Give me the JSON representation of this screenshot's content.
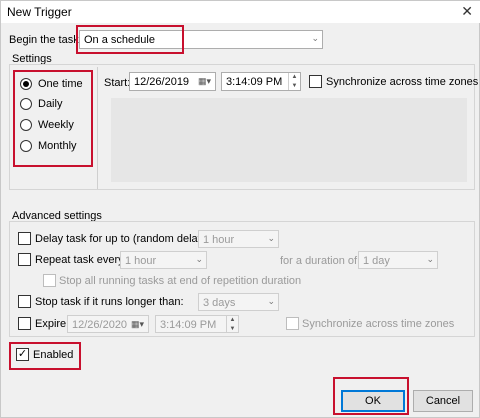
{
  "window": {
    "title": "New Trigger",
    "close_glyph": "✕"
  },
  "begin": {
    "label": "Begin the task:",
    "value": "On a schedule"
  },
  "settings": {
    "label": "Settings",
    "radios": [
      {
        "label": "One time",
        "checked": true
      },
      {
        "label": "Daily",
        "checked": false
      },
      {
        "label": "Weekly",
        "checked": false
      },
      {
        "label": "Monthly",
        "checked": false
      }
    ],
    "start_label": "Start:",
    "start_date": "12/26/2019",
    "start_time": "3:14:09 PM",
    "sync_label": "Synchronize across time zones"
  },
  "advanced": {
    "label": "Advanced settings",
    "delay_label": "Delay task for up to (random delay):",
    "delay_value": "1 hour",
    "repeat_label": "Repeat task every:",
    "repeat_value": "1 hour",
    "duration_label": "for a duration of:",
    "duration_value": "1 day",
    "stop_all_label": "Stop all running tasks at end of repetition duration",
    "stop_long_label": "Stop task if it runs longer than:",
    "stop_long_value": "3 days",
    "expire_label": "Expire:",
    "expire_date": "12/26/2020",
    "expire_time": "3:14:09 PM",
    "expire_sync_label": "Synchronize across time zones"
  },
  "enabled": {
    "label": "Enabled",
    "checked": true
  },
  "buttons": {
    "ok": "OK",
    "cancel": "Cancel"
  },
  "glyphs": {
    "check": "✓",
    "chevron": "⌄",
    "calendar": "▦▾",
    "spin_up": "▲",
    "spin_down": "▼"
  },
  "colors": {
    "highlight": "#c8102e",
    "default_button": "#0078d7"
  }
}
